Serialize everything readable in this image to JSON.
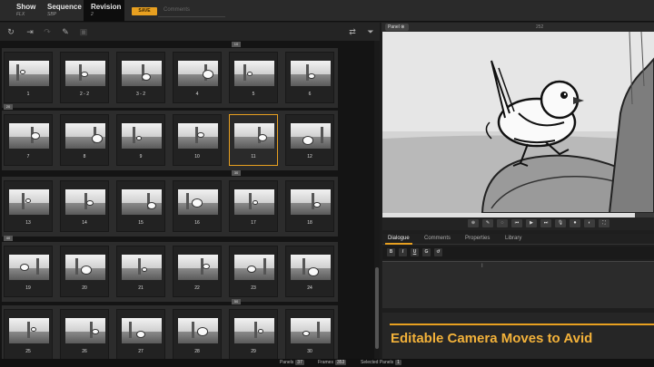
{
  "header": {
    "crumbs": [
      {
        "label": "Show",
        "value": "FLX"
      },
      {
        "label": "Sequence",
        "value": "SBP"
      },
      {
        "label": "Revision",
        "value": "2"
      }
    ],
    "save_label": "SAVE",
    "comments_label": "Comments"
  },
  "toolbar": {
    "icons": [
      "refresh-icon",
      "import-icon",
      "redo-icon",
      "brush-icon",
      "crop-icon"
    ],
    "right_icons": [
      "swap-icon",
      "filter-icon"
    ]
  },
  "grid": {
    "row_tabs": [
      "10",
      "20",
      "30",
      "40",
      "50"
    ],
    "rows": [
      [
        {
          "label": "1"
        },
        {
          "label": "2 - 2"
        },
        {
          "label": "3 - 2"
        },
        {
          "label": "4"
        },
        {
          "label": "5"
        },
        {
          "label": "6"
        }
      ],
      [
        {
          "label": "7"
        },
        {
          "label": "8"
        },
        {
          "label": "9"
        },
        {
          "label": "10"
        },
        {
          "label": "11",
          "selected": true
        },
        {
          "label": "12"
        }
      ],
      [
        {
          "label": "13"
        },
        {
          "label": "14"
        },
        {
          "label": "15"
        },
        {
          "label": "16"
        },
        {
          "label": "17"
        },
        {
          "label": "18"
        }
      ],
      [
        {
          "label": "19"
        },
        {
          "label": "20"
        },
        {
          "label": "21"
        },
        {
          "label": "22"
        },
        {
          "label": "23"
        },
        {
          "label": "24"
        }
      ],
      [
        {
          "label": "25"
        },
        {
          "label": "26"
        },
        {
          "label": "27"
        },
        {
          "label": "28"
        },
        {
          "label": "29"
        },
        {
          "label": "30"
        }
      ]
    ]
  },
  "viewer": {
    "tab_label": "Panel",
    "frame_number": "252",
    "progress": 0.93
  },
  "transport": {
    "buttons": [
      "⊕",
      "✎",
      "◌",
      "⏮",
      "▶",
      "⏭",
      "🎙",
      "⏺",
      "◐",
      "⛶"
    ]
  },
  "info_tabs": [
    "Dialogue",
    "Comments",
    "Properties",
    "Library"
  ],
  "format_buttons": [
    "B",
    "I",
    "U",
    "G",
    "↺"
  ],
  "banner": {
    "title": "Editable Camera Moves to Avid"
  },
  "statusbar": {
    "panels_label": "Panels",
    "panels_count": "37",
    "frames_label": "Frames",
    "frames_count": "353",
    "selected_label": "Selected Panels",
    "selected_count": "1"
  },
  "colors": {
    "accent": "#e8a020",
    "banner_text": "#f3b23a"
  }
}
